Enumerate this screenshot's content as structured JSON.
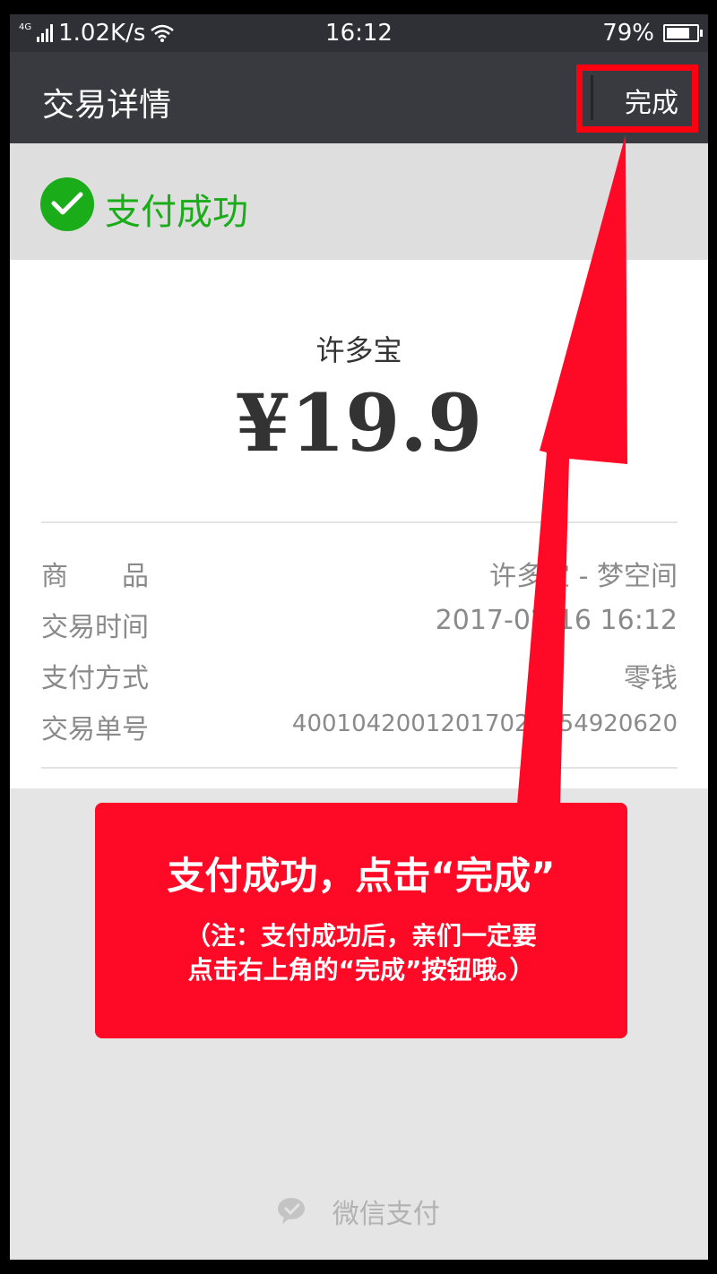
{
  "status_bar": {
    "network_type": "4G",
    "speed": "1.02K/s",
    "time": "16:12",
    "battery_percent": "79%",
    "battery_level": 0.79
  },
  "header": {
    "title": "交易详情",
    "done_label": "完成"
  },
  "result": {
    "label": "支付成功",
    "color": "#1aad19"
  },
  "payment": {
    "merchant": "许多宝",
    "amount": "¥19.9"
  },
  "details": [
    {
      "key": "商　　品",
      "value": "许多宝 - 梦空间"
    },
    {
      "key": "交易时间",
      "value": "2017-02-16 16:12"
    },
    {
      "key": "支付方式",
      "value": "零钱"
    },
    {
      "key": "交易单号",
      "value": "40010420012017021654920620"
    }
  ],
  "annotation": {
    "headline": "支付成功，点击“完成”",
    "note_line1": "（注：支付成功后，亲们一定要",
    "note_line2": "点击右上角的“完成”按钮哦。）",
    "color": "#ff0a26"
  },
  "footer": {
    "brand": "微信支付"
  }
}
